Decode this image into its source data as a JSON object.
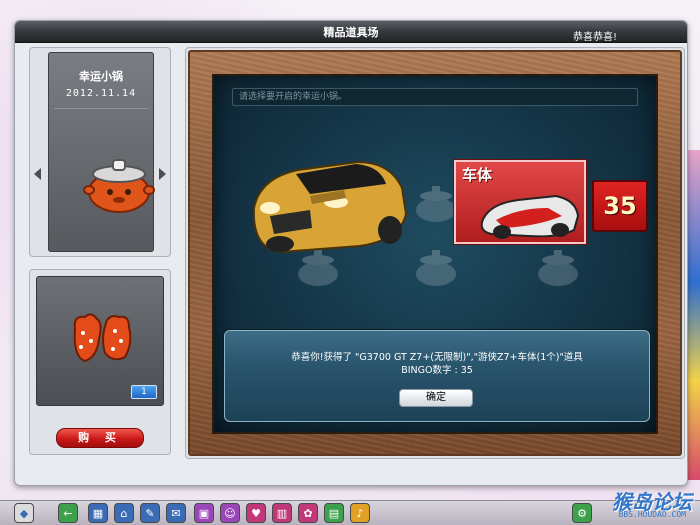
{
  "window": {
    "title": "精品道具场",
    "title_right": "恭喜恭喜!"
  },
  "item_panel": {
    "name": "幸运小锅",
    "date": "2012.11.14"
  },
  "shop": {
    "quantity": "1",
    "buy_label": "购  买"
  },
  "board": {
    "search_placeholder": "请选择要开启的幸运小锅。",
    "card_label": "车体",
    "bingo_number": "35"
  },
  "dialog": {
    "line1": "恭喜你!获得了 \"G3700 GT Z7+(无限制)\",\"游侠Z7+车体(1个)\"道具",
    "line2": "BINGO数字 : 35",
    "ok_label": "确定"
  },
  "taskbar": {
    "buttons": [
      "back-icon",
      "save-icon",
      "home-icon",
      "tools-icon",
      "mail-icon",
      "gift-icon",
      "friends-icon",
      "chat-icon",
      "book-icon",
      "event-icon",
      "photo-icon",
      "music-icon"
    ],
    "watermark": "猴岛论坛",
    "watermark_sub": "BBS.HOUDAO.COM"
  },
  "colors": {
    "title_bar": "#35383d",
    "buy_button": "#c91818",
    "board": "#143446",
    "badge": "#a80e0e",
    "dialog": "#28546c"
  }
}
